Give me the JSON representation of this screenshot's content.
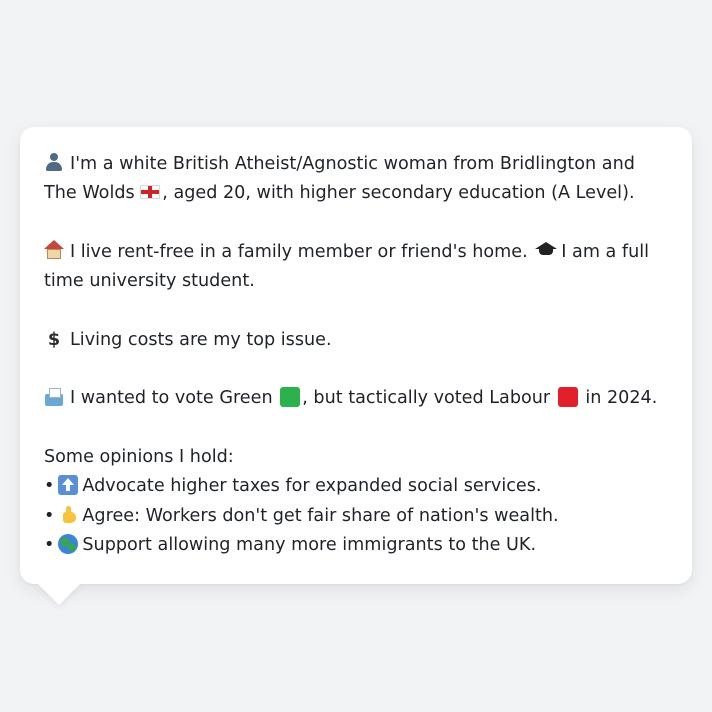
{
  "card": {
    "intro": {
      "icon": "person-silhouette-icon",
      "text_before_flag": "I'm a white British Atheist/Agnostic woman from Bridlington and The Wolds",
      "flag": "england-flag-icon",
      "text_after_flag": ", aged 20, with higher secondary education (A Level)."
    },
    "housing": {
      "icon": "house-icon",
      "text": "I live rent-free in a family member or friend's home.",
      "icon2": "graduation-cap-icon",
      "text2": "I am a full time university student."
    },
    "issue": {
      "icon": "dollar-sign-icon",
      "text": "Living costs are my top issue."
    },
    "vote": {
      "icon": "ballot-box-icon",
      "text_part1": "I wanted to vote Green",
      "green_square": "green-square-icon",
      "text_part2": ", but tactically voted Labour",
      "red_square": "red-square-icon",
      "text_part3": "in 2024."
    },
    "opinions": {
      "heading": "Some opinions I hold:",
      "items": [
        {
          "bullet": "•",
          "icon": "up-arrow-icon",
          "text": "Advocate higher taxes for expanded social services."
        },
        {
          "bullet": "•",
          "icon": "thumbs-up-icon",
          "text": "Agree: Workers don't get fair share of nation's wealth."
        },
        {
          "bullet": "•",
          "icon": "globe-icon",
          "text": "Support allowing many more immigrants to the UK."
        }
      ]
    }
  },
  "colors": {
    "background": "#f2f3f5",
    "card": "#ffffff",
    "text": "#1f2328",
    "green": "#2bb24c",
    "red": "#e2202c"
  }
}
